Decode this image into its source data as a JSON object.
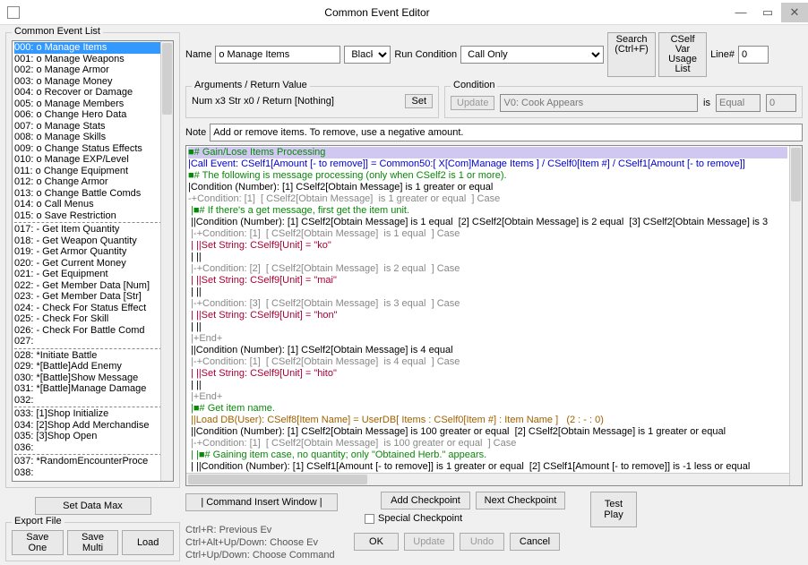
{
  "window": {
    "title": "Common Event Editor"
  },
  "left": {
    "legend": "Common Event List",
    "items": [
      "000: o Manage Items",
      "001: o Manage Weapons",
      "002: o Manage Armor",
      "003: o Manage Money",
      "004: o Recover or Damage",
      "005: o Manage Members",
      "006: o Change Hero Data",
      "007: o Manage Stats",
      "008: o Manage Skills",
      "009: o Change Status Effects",
      "010: o Manage EXP/Level",
      "011: o Change Equipment",
      "012: o Change Armor",
      "013: o Change Battle Comds",
      "014: o Call Menus",
      "015: o Save Restriction",
      "---",
      "017: - Get Item Quantity",
      "018: - Get Weapon Quantity",
      "019: - Get Armor Quantity",
      "020: - Get Current Money",
      "021: - Get Equipment",
      "022: - Get Member Data [Num]",
      "023: - Get Member Data [Str]",
      "024: - Check For Status Effect",
      "025: - Check For Skill",
      "026: - Check For Battle Comd",
      "027:",
      "---",
      "028: *Initiate Battle",
      "029: *[Battle]Add Enemy",
      "030: *[Battle]Show Message",
      "031: *[Battle]Manage Damage",
      "032:",
      "---",
      "033: [1]Shop Initialize",
      "034: [2]Shop Add Merchandise",
      "035: [3]Shop Open",
      "036:",
      "---",
      "037: *RandomEncounterProce",
      "038:"
    ],
    "selectedIndex": 0,
    "setDataMax": "Set Data Max",
    "exportLegend": "Export File",
    "saveOne": "Save One",
    "saveMulti": "Save Multi",
    "load": "Load"
  },
  "top": {
    "nameLabel": "Name",
    "nameValue": "o Manage Items",
    "colorValue": "Black",
    "runCondLabel": "Run Condition",
    "runCondValue": "Call Only",
    "search": "Search\n(Ctrl+F)",
    "cselfvar": "CSelf Var\nUsage List",
    "lineLabel": "Line#",
    "lineValue": "0"
  },
  "args": {
    "legend": "Arguments / Return Value",
    "summary": "Num x3  Str x0 / Return [Nothing]",
    "set": "Set"
  },
  "cond": {
    "legend": "Condition",
    "updateBtn": "Update",
    "varValue": "V0: Cook Appears",
    "isLabel": "is",
    "opValue": "Equal",
    "numValue": "0"
  },
  "note": {
    "label": "Note",
    "value": "Add or remove items. To remove, use a negative amount."
  },
  "code": [
    {
      "cls": "ln-hdr",
      "t": "■# Gain/Lose Items Processing"
    },
    {
      "cls": "c-call",
      "t": "|Call Event: CSelf1[Amount [- to remove]] = Common50:[ X[Com]Manage Items ] / CSelf0[Item #] / CSelf1[Amount [- to remove]]"
    },
    {
      "cls": "c-cmt",
      "t": "■# The following is message processing (only when CSelf2 is 1 or more)."
    },
    {
      "cls": "c-cond",
      "t": "|Condition (Number): [1] CSelf2[Obtain Message] is 1 greater or equal"
    },
    {
      "cls": "c-grey",
      "t": "-+Condition: [1]  [ CSelf2[Obtain Message]  is 1 greater or equal  ] Case"
    },
    {
      "cls": "c-cmt",
      "t": " |■# If there's a get message, first get the item unit."
    },
    {
      "cls": "c-cond",
      "t": " ||Condition (Number): [1] CSelf2[Obtain Message] is 1 equal  [2] CSelf2[Obtain Message] is 2 equal  [3] CSelf2[Obtain Message] is 3"
    },
    {
      "cls": "c-grey",
      "t": " |-+Condition: [1]  [ CSelf2[Obtain Message]  is 1 equal  ] Case"
    },
    {
      "cls": "c-red",
      "t": " | ||Set String: CSelf9[Unit] = \"ko\""
    },
    {
      "cls": "c-cond",
      "t": " | ||"
    },
    {
      "cls": "c-grey",
      "t": " |-+Condition: [2]  [ CSelf2[Obtain Message]  is 2 equal  ] Case"
    },
    {
      "cls": "c-red",
      "t": " | ||Set String: CSelf9[Unit] = \"mai\""
    },
    {
      "cls": "c-cond",
      "t": " | ||"
    },
    {
      "cls": "c-grey",
      "t": " |-+Condition: [3]  [ CSelf2[Obtain Message]  is 3 equal  ] Case"
    },
    {
      "cls": "c-red",
      "t": " | ||Set String: CSelf9[Unit] = \"hon\""
    },
    {
      "cls": "c-cond",
      "t": " | ||"
    },
    {
      "cls": "c-grey",
      "t": " |+End+"
    },
    {
      "cls": "c-cond",
      "t": " ||Condition (Number): [1] CSelf2[Obtain Message] is 4 equal"
    },
    {
      "cls": "c-grey",
      "t": " |-+Condition: [1]  [ CSelf2[Obtain Message]  is 4 equal  ] Case"
    },
    {
      "cls": "c-red",
      "t": " | ||Set String: CSelf9[Unit] = \"hito\""
    },
    {
      "cls": "c-cond",
      "t": " | ||"
    },
    {
      "cls": "c-grey",
      "t": " |+End+"
    },
    {
      "cls": "c-cmt",
      "t": " |■# Get item name."
    },
    {
      "cls": "c-orange",
      "t": " ||Load DB(User): CSelf8[Item Name] = UserDB[ Items : CSelf0[Item #] : Item Name ]   (2 : - : 0)"
    },
    {
      "cls": "c-cond",
      "t": " ||Condition (Number): [1] CSelf2[Obtain Message] is 100 greater or equal  [2] CSelf2[Obtain Message] is 1 greater or equal"
    },
    {
      "cls": "c-grey",
      "t": " |-+Condition: [1]  [ CSelf2[Obtain Message]  is 100 greater or equal  ] Case"
    },
    {
      "cls": "c-cmt",
      "t": " | |■# Gaining item case, no quantity; only \"Obtained Herb.\" appears."
    },
    {
      "cls": "c-cond",
      "t": " | ||Condition (Number): [1] CSelf1[Amount [- to remove]] is 1 greater or equal  [2] CSelf1[Amount [- to remove]] is -1 less or equal"
    }
  ],
  "bottom": {
    "cmdInsert": "| Command Insert Window |",
    "addChk": "Add Checkpoint",
    "nextChk": "Next Checkpoint",
    "specialChk": "Special Checkpoint",
    "ok": "OK",
    "update": "Update",
    "undo": "Undo",
    "cancel": "Cancel",
    "testPlay": "Test\nPlay",
    "shortcuts": "Ctrl+R: Previous Ev\nCtrl+Alt+Up/Down: Choose Ev\nCtrl+Up/Down: Choose Command"
  }
}
